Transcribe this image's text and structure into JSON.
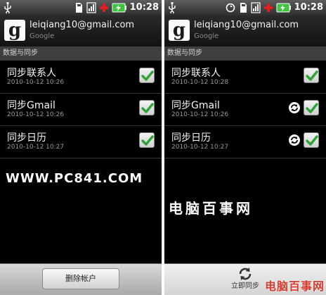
{
  "status_bar": {
    "time": "10:28",
    "icons": [
      "usb-icon",
      "sd-card-icon",
      "signal-icon",
      "medical-cross-icon",
      "battery-charging-icon"
    ]
  },
  "account": {
    "email": "leiqiang10@gmail.com",
    "provider": "Google",
    "logo_letter": "g"
  },
  "section_title": "数据与同步",
  "left_screen": {
    "items": [
      {
        "title": "同步联系人",
        "date": "2010-10-12 10:26",
        "checked": true
      },
      {
        "title": "同步Gmail",
        "date": "2010-10-12 10:26",
        "checked": true
      },
      {
        "title": "同步日历",
        "date": "2010-10-12 10:27",
        "checked": true
      }
    ],
    "watermark": "WWW.PC841.COM",
    "bottom_button": "删除帐户"
  },
  "right_screen": {
    "items": [
      {
        "title": "同步联系人",
        "date": "2010-10-12 10:28",
        "checked": true,
        "syncing": false
      },
      {
        "title": "同步Gmail",
        "date": "2010-10-12 10:26",
        "checked": true,
        "syncing": true
      },
      {
        "title": "同步日历",
        "date": "2010-10-12 10:27",
        "checked": true,
        "syncing": true
      }
    ],
    "watermark": "电脑百事网",
    "sync_now_label": "立即同步",
    "corner_logo": "电脑百事网"
  },
  "colors": {
    "check_green": "#2fa336",
    "screen_bg": "#000000",
    "section_bg": "#3f3f3f",
    "logo_red": "#d63b2e"
  }
}
